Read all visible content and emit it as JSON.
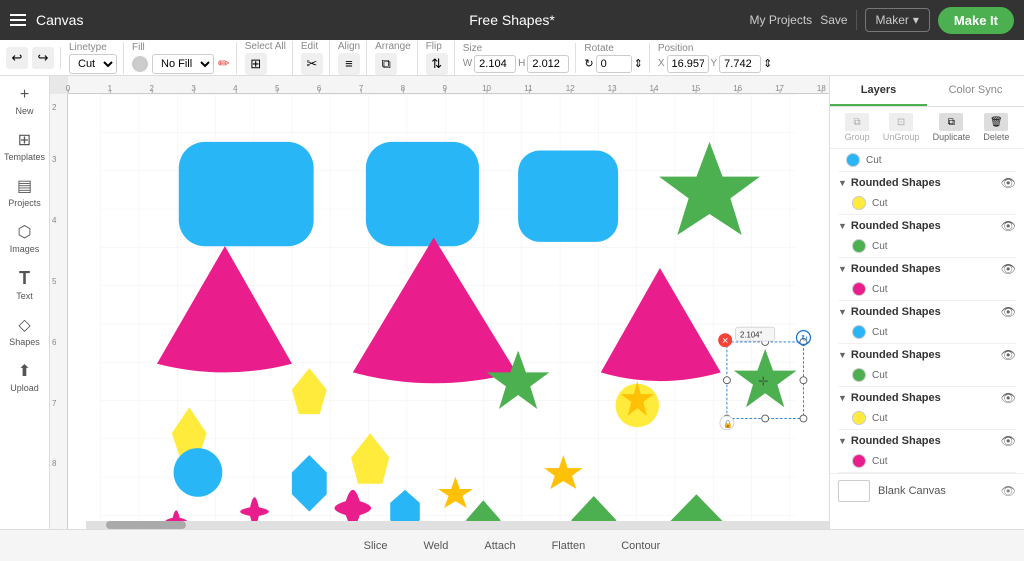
{
  "header": {
    "hamburger_label": "menu",
    "app_title": "Canvas",
    "project_title": "Free Shapes*",
    "my_projects": "My Projects",
    "save": "Save",
    "maker": "Maker",
    "make_it": "Make It"
  },
  "toolbar": {
    "linetype_label": "Linetype",
    "linetype_value": "Cut",
    "fill_label": "Fill",
    "fill_value": "No Fill",
    "select_all_label": "Select All",
    "edit_label": "Edit",
    "align_label": "Align",
    "arrange_label": "Arrange",
    "flip_label": "Flip",
    "size_label": "Size",
    "rotate_label": "Rotate",
    "position_label": "Position",
    "size_w": "2.104",
    "size_h": "2.012",
    "rotate_val": "0",
    "pos_x": "16.957",
    "pos_y": "7.742"
  },
  "sidebar": {
    "items": [
      {
        "id": "new",
        "icon": "+",
        "label": "New"
      },
      {
        "id": "templates",
        "icon": "⊞",
        "label": "Templates"
      },
      {
        "id": "projects",
        "icon": "📁",
        "label": "Projects"
      },
      {
        "id": "images",
        "icon": "🖼",
        "label": "Images"
      },
      {
        "id": "text",
        "icon": "T",
        "label": "Text"
      },
      {
        "id": "shapes",
        "icon": "◇",
        "label": "Shapes"
      },
      {
        "id": "upload",
        "icon": "⬆",
        "label": "Upload"
      }
    ]
  },
  "right_panel": {
    "tabs": [
      {
        "id": "layers",
        "label": "Layers",
        "active": true
      },
      {
        "id": "color_sync",
        "label": "Color Sync",
        "active": false
      }
    ],
    "toolbar": [
      {
        "id": "group",
        "label": "Group",
        "disabled": true
      },
      {
        "id": "ungroup",
        "label": "UnGroup",
        "disabled": true
      },
      {
        "id": "duplicate",
        "label": "Duplicate",
        "disabled": false
      },
      {
        "id": "delete",
        "label": "Delete",
        "disabled": false
      }
    ],
    "layers": [
      {
        "name": "Rounded Shapes",
        "sub_label": "Cut",
        "color": "#00bcd4",
        "expanded": true
      },
      {
        "name": "Rounded Shapes",
        "sub_label": "Cut",
        "color": "#ffeb3b",
        "expanded": true
      },
      {
        "name": "Rounded Shapes",
        "sub_label": "Cut",
        "color": "#4caf50",
        "expanded": true
      },
      {
        "name": "Rounded Shapes",
        "sub_label": "Cut",
        "color": "#e91e8c",
        "expanded": true
      },
      {
        "name": "Rounded Shapes",
        "sub_label": "Cut",
        "color": "#00bcd4",
        "expanded": true
      },
      {
        "name": "Rounded Shapes",
        "sub_label": "Cut",
        "color": "#4caf50",
        "expanded": true
      },
      {
        "name": "Rounded Shapes",
        "sub_label": "Cut",
        "color": "#ffeb3b",
        "expanded": true
      },
      {
        "name": "Rounded Shapes",
        "sub_label": "Cut",
        "color": "#e91e8c",
        "expanded": true
      }
    ],
    "blank_canvas": "Blank Canvas"
  },
  "bottom_bar": {
    "buttons": [
      "Slice",
      "Weld",
      "Attach",
      "Flatten",
      "Contour"
    ]
  },
  "canvas": {
    "dim_tooltip": "2.104\""
  }
}
